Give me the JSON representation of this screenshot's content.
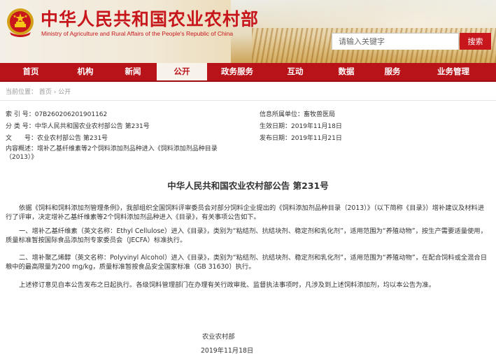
{
  "header": {
    "title": "中华人民共和国农业农村部",
    "subtitle": "Ministry of Agriculture and Rural Affairs of the People's Republic of China",
    "search_placeholder": "请输入关键字",
    "search_button": "搜索"
  },
  "nav": {
    "items": [
      {
        "label": "首页",
        "active": false
      },
      {
        "label": "机构",
        "active": false
      },
      {
        "label": "新闻",
        "active": false
      },
      {
        "label": "公开",
        "active": true
      },
      {
        "label": "政务服务",
        "active": false
      },
      {
        "label": "互动",
        "active": false
      },
      {
        "label": "数据",
        "active": false
      },
      {
        "label": "服务",
        "active": false
      },
      {
        "label": "业务管理",
        "active": false
      }
    ]
  },
  "breadcrumb": {
    "label": "当前位置：",
    "home": "首页",
    "sep": "›",
    "current": "公开"
  },
  "meta": {
    "index_key": "索 引 号：",
    "index_val": "07B260206201901162",
    "category_key": "分 类 号：",
    "category_val": "中华人民共和国农业农村部公告 第231号",
    "docno_key": "文　　号：",
    "docno_val": "农业农村部公告 第231号",
    "summary_key": "内容概述：",
    "summary_val": "增补乙基纤维素等2个饲料添加剂品种进入《饲料添加剂品种目录（2013）》",
    "owner_key": "信息所属单位：",
    "owner_val": "畜牧兽医局",
    "date_key": "生效日期：",
    "date_val": "2019年11月18日",
    "publish_key": "发布日期：",
    "publish_val": "2019年11月21日"
  },
  "article": {
    "title": "中华人民共和国农业农村部公告 第231号",
    "paragraphs": [
      "依据《饲料和饲料添加剂管理条例》，我部组织全国饲料评审委员会对部分饲料企业提出的《饲料添加剂品种目录（2013）》（以下简称《目录》）增补建议及材料进行了评审，决定增补乙基纤维素等2个饲料添加剂品种进入《目录》，有关事项公告如下。",
      "一、增补乙基纤维素（英文名称：Ethyl Cellulose）进入《目录》，类别为“粘结剂、抗结块剂、稳定剂和乳化剂”，适用范围为“养殖动物”，按生产需要适量使用，质量标准暂按国际食品添加剂专家委员会（JECFA）标准执行。",
      "二、增补聚乙烯醇（英文名称：Polyvinyl Alcohol）进入《目录》，类别为“粘结剂、抗结块剂、稳定剂和乳化剂”，适用范围为“养殖动物”，在配合饲料或全混合日粮中的最高限量为200 mg/kg，质量标准暂按食品安全国家标准（GB 31630）执行。",
      "上述修订意见自本公告发布之日起执行。各级饲料管理部门在办理有关行政审批、监督执法事项时，凡涉及到上述饲料添加剂，均以本公告为准。"
    ],
    "signer": "农业农村部",
    "sign_date": "2019年11月18日"
  },
  "colors": {
    "brand_red": "#c8161d",
    "nav_red": "#b9131a"
  }
}
